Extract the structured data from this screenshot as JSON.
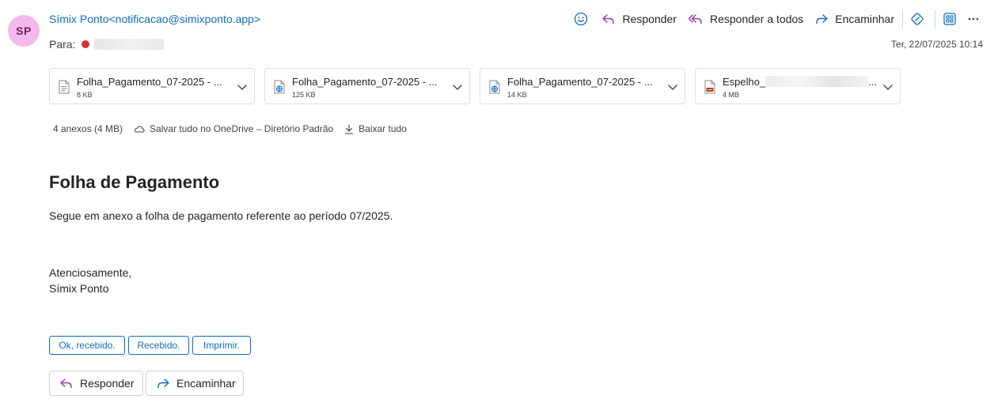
{
  "email": {
    "avatar_initials": "SP",
    "sender": "Símix Ponto<notificacao@simixponto.app>",
    "to_label": "Para:",
    "to_value": "",
    "date": "Ter, 22/07/2025 10:14"
  },
  "toolbar": {
    "reply": "Responder",
    "reply_all": "Responder a todos",
    "forward": "Encaminhar"
  },
  "attachments": [
    {
      "name": "Folha_Pagamento_07-2025 - ...",
      "size": "8 KB",
      "icon": "document-icon"
    },
    {
      "name": "Folha_Pagamento_07-2025 - ...",
      "size": "125 KB",
      "icon": "web-document-icon"
    },
    {
      "name": "Folha_Pagamento_07-2025 - ...",
      "size": "14 KB",
      "icon": "web-document-icon"
    },
    {
      "name": "Espelho_",
      "name_suffix": "...",
      "size": "4 MB",
      "icon": "pdf-icon"
    }
  ],
  "attachment_bar": {
    "count": "4 anexos (4 MB)",
    "save_onedrive": "Salvar tudo no OneDrive – Diretório Padrão",
    "download_all": "Baixar tudo"
  },
  "body": {
    "title": "Folha de Pagamento",
    "text": "Segue em anexo a folha de pagamento referente ao período 07/2025.",
    "closing": "Atenciosamente,",
    "signature": "Símix Ponto"
  },
  "quick_replies": [
    "Ok, recebido.",
    "Recebido.",
    "Imprimir."
  ],
  "bottom_actions": {
    "reply": "Responder",
    "forward": "Encaminhar"
  },
  "colors": {
    "accent": "#0f6cbd",
    "avatar_bg": "#f4b8ec",
    "status_dot": "#d13438",
    "reply_all_icon": "#8a3ea8"
  }
}
